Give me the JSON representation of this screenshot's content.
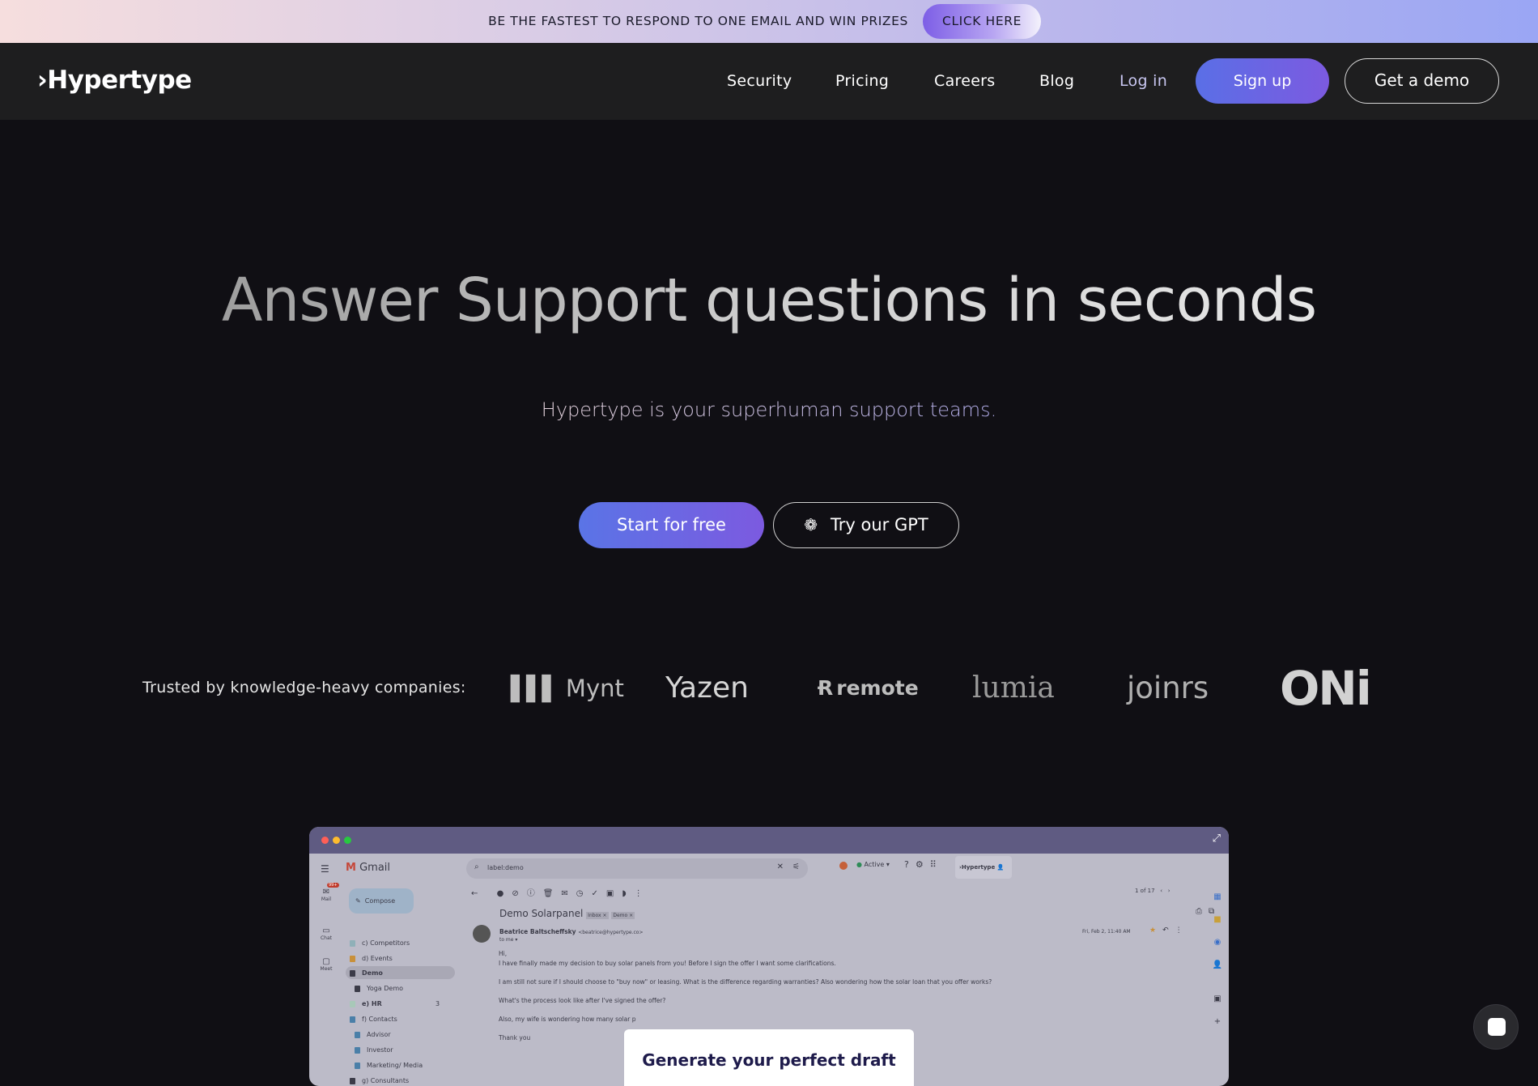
{
  "banner": {
    "text": "BE THE FASTEST TO RESPOND TO ONE EMAIL AND WIN PRIZES",
    "cta": "CLICK HERE"
  },
  "nav": {
    "logo": "Hypertype",
    "links": [
      "Security",
      "Pricing",
      "Careers",
      "Blog",
      "Log in"
    ],
    "signup": "Sign up",
    "demo": "Get a demo"
  },
  "hero": {
    "headline": "Answer Support questions in seconds",
    "subtitle": "Hypertype is your superhuman support teams.",
    "start": "Start for free",
    "gpt": "Try our GPT",
    "gpt_icon": "openai-icon"
  },
  "trusted": {
    "label": "Trusted by knowledge-heavy companies:",
    "logos": [
      "Mynt",
      "Yazen",
      "remote",
      "lumia",
      "joinrs",
      "ONi"
    ]
  },
  "mockup": {
    "app": "Gmail",
    "search": "label:demo",
    "status": "Active",
    "badge": "99+",
    "rail": [
      "Mail",
      "Chat",
      "Meet"
    ],
    "compose": "Compose",
    "labels": [
      "c) Competitors",
      "d) Events",
      "Demo",
      "Yoga Demo",
      "e) HR",
      "f) Contacts",
      "Advisor",
      "Investor",
      "Marketing/ Media",
      "g) Consultants"
    ],
    "hr_count": "3",
    "pager": "1 of 17",
    "subject": "Demo Solarpanel",
    "tags": [
      "Inbox ×",
      "Demo ×"
    ],
    "sender": "Beatrice Baltscheffsky",
    "sender_email": "<beatrice@hypertype.co>",
    "to": "to me ▾",
    "date": "Fri, Feb 2, 11:40 AM",
    "body": [
      "Hi,",
      "I have finally made my decision to buy solar panels from you! Before I sign the offer I want some clarifications.",
      "I am still not sure if I should choose to \"buy now\" or leasing. What is the difference regarding warranties? Also wondering how the solar loan that you offer works?",
      "What's the process look like after I've signed the offer?",
      "Also, my wife is wondering how many solar p",
      "Thank you"
    ],
    "ext": "Hypertype",
    "popup": "Generate your perfect draft"
  },
  "colors": {
    "accent_start": "#5a74e6",
    "accent_end": "#7c5ae0",
    "background": "#100f14",
    "nav": "#1e1e1f"
  }
}
